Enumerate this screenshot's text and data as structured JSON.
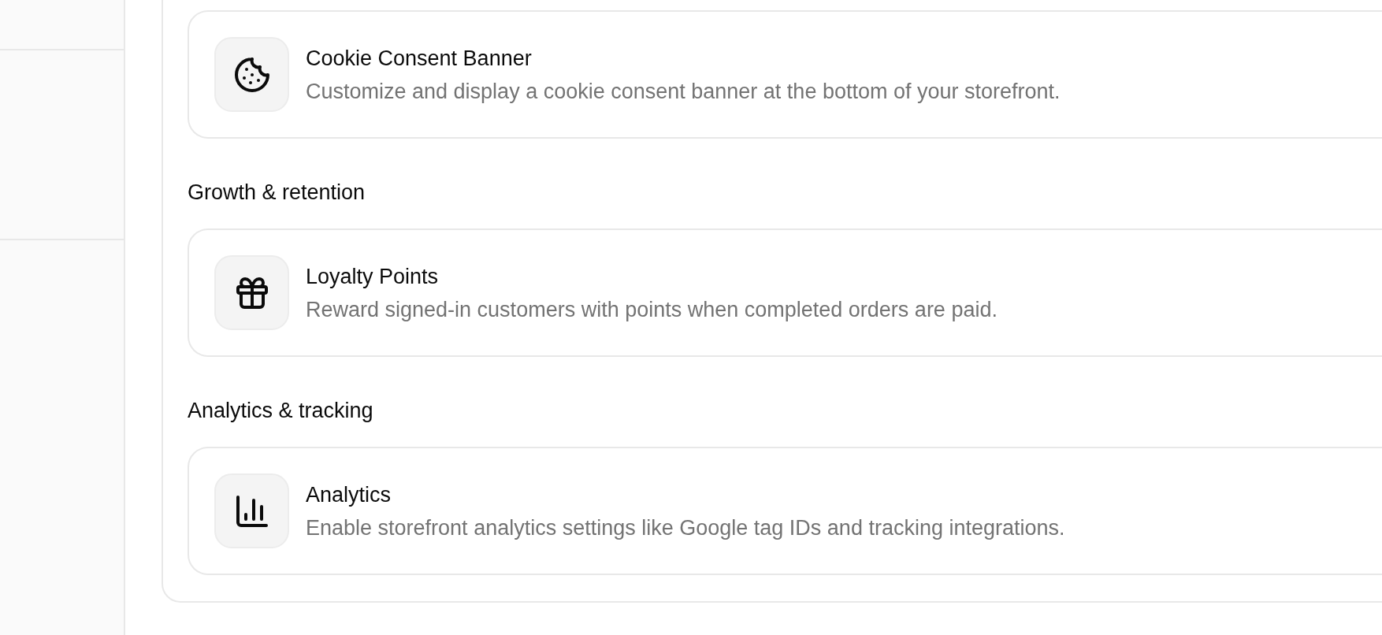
{
  "sections": [
    {
      "items": [
        {
          "title": "Cookie Consent Banner",
          "description": "Customize and display a cookie consent banner at the bottom of your storefront."
        }
      ]
    },
    {
      "heading": "Growth & retention",
      "items": [
        {
          "title": "Loyalty Points",
          "description": "Reward signed-in customers with points when completed orders are paid."
        }
      ]
    },
    {
      "heading": "Analytics & tracking",
      "items": [
        {
          "title": "Analytics",
          "description": "Enable storefront analytics settings like Google tag IDs and tracking integrations."
        }
      ]
    }
  ]
}
